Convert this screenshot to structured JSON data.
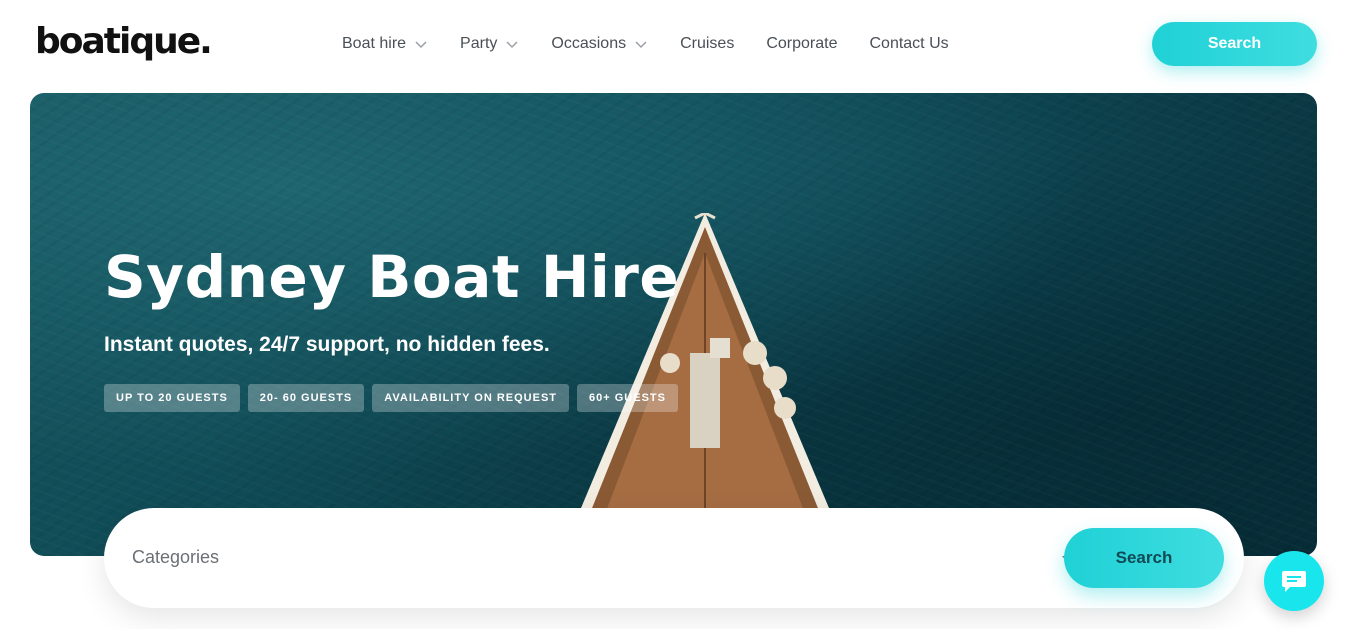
{
  "brand": {
    "logo_text": "boatique."
  },
  "nav": {
    "items": [
      {
        "label": "Boat hire",
        "has_dropdown": true
      },
      {
        "label": "Party",
        "has_dropdown": true
      },
      {
        "label": "Occasions",
        "has_dropdown": true
      },
      {
        "label": "Cruises",
        "has_dropdown": false
      },
      {
        "label": "Corporate",
        "has_dropdown": false
      },
      {
        "label": "Contact Us",
        "has_dropdown": false
      }
    ],
    "search_label": "Search"
  },
  "hero": {
    "title": "Sydney Boat Hire",
    "subtitle": "Instant quotes, 24/7 support, no hidden fees.",
    "tags": [
      "UP TO 20 GUESTS",
      "20- 60 GUESTS",
      "AVAILABILITY ON REQUEST",
      "60+ GUESTS"
    ]
  },
  "search_bar": {
    "category_placeholder": "Categories",
    "search_label": "Search"
  },
  "chat": {
    "icon": "chat-icon"
  },
  "colors": {
    "accent": "#1fd1d6",
    "chat": "#18e6ec",
    "hero_sea": "#0f4a55",
    "text_nav": "#4a5056"
  }
}
